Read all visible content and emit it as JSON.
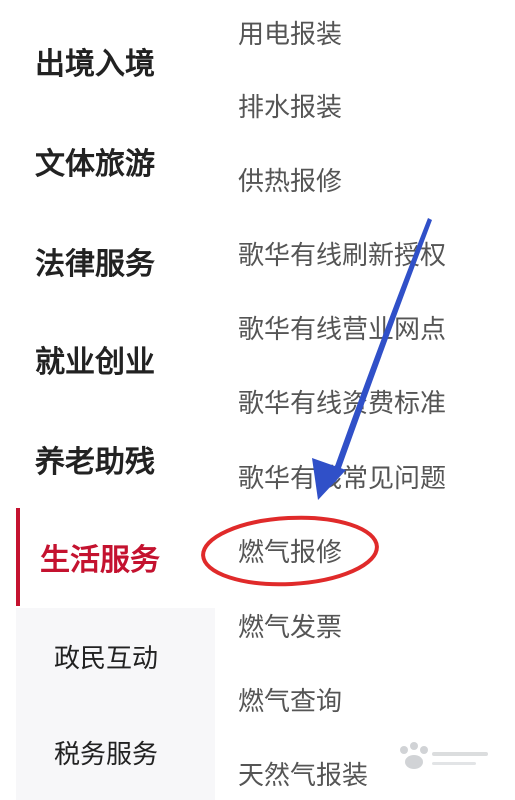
{
  "sidebar": {
    "categories": [
      {
        "label": "出境入境"
      },
      {
        "label": "文体旅游"
      },
      {
        "label": "法律服务"
      },
      {
        "label": "就业创业"
      },
      {
        "label": "养老助残"
      },
      {
        "label": "生活服务",
        "active": true
      }
    ],
    "subcategories": [
      {
        "label": "政民互动"
      },
      {
        "label": "税务服务"
      }
    ]
  },
  "services": [
    {
      "label": "用电报装"
    },
    {
      "label": "排水报装"
    },
    {
      "label": "供热报修"
    },
    {
      "label": "歌华有线刷新授权"
    },
    {
      "label": "歌华有线营业网点"
    },
    {
      "label": "歌华有线资费标准"
    },
    {
      "label": "歌华有线常见问题"
    },
    {
      "label": "燃气报修",
      "highlighted": true
    },
    {
      "label": "燃气发票"
    },
    {
      "label": "燃气查询"
    },
    {
      "label": "天然气报装"
    }
  ],
  "colors": {
    "active": "#c4122f",
    "annotation_circle": "#e02a2a",
    "annotation_arrow": "#3050c8"
  }
}
